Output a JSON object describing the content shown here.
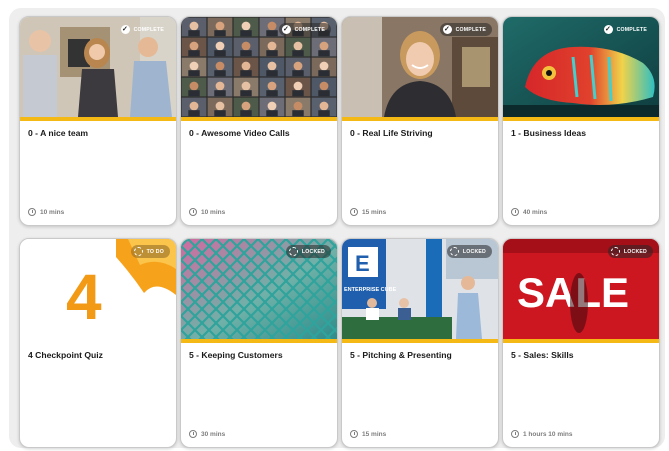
{
  "modules": [
    {
      "title": "0 - A nice team",
      "duration": "10 mins",
      "status": "COMPLETE",
      "image": "team-photo"
    },
    {
      "title": "0 - Awesome Video Calls",
      "duration": "10 mins",
      "status": "COMPLETE",
      "image": "video-call-grid"
    },
    {
      "title": "0 - Real Life Striving",
      "duration": "15 mins",
      "status": "COMPLETE",
      "image": "smiling-woman"
    },
    {
      "title": "1 - Business Ideas",
      "duration": "40 mins",
      "status": "COMPLETE",
      "image": "chameleon"
    },
    {
      "title": "4 Checkpoint Quiz",
      "duration": "",
      "status": "TO DO",
      "image": "number-4-graphic"
    },
    {
      "title": "5 - Keeping Customers",
      "duration": "30 mins",
      "status": "LOCKED",
      "image": "chain-link-fence"
    },
    {
      "title": "5 - Pitching & Presenting",
      "duration": "15 mins",
      "status": "LOCKED",
      "image": "enterprise-cube-stage"
    },
    {
      "title": "5 - Sales: Skills",
      "duration": "1 hours 10 mins",
      "status": "LOCKED",
      "image": "sale-sign"
    }
  ],
  "thumbnail_text": {
    "sale": "SALE",
    "enterprise": "ENTERPRISE CUBE",
    "four": "4"
  },
  "colors": {
    "accent_bar": "#f5b915",
    "badge_text": "#ffffff",
    "panel_bg": "#eeeeee"
  }
}
